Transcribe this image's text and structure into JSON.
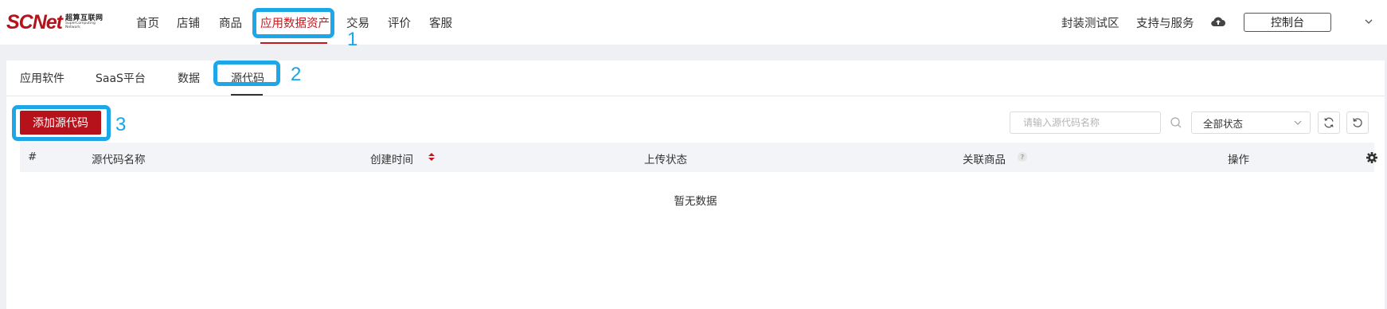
{
  "header": {
    "logo": {
      "main": "SCNet",
      "cn": "超算互联网",
      "en1": "SuperComputing",
      "en2": "Network"
    },
    "nav": [
      {
        "label": "首页"
      },
      {
        "label": "店铺"
      },
      {
        "label": "商品"
      },
      {
        "label": "应用数据资产",
        "active": true
      },
      {
        "label": "交易"
      },
      {
        "label": "评价"
      },
      {
        "label": "客服"
      }
    ],
    "right": {
      "sandbox": "封装测试区",
      "support": "支持与服务",
      "console": "控制台"
    }
  },
  "annotations": [
    "1",
    "2",
    "3"
  ],
  "subtabs": [
    {
      "label": "应用软件"
    },
    {
      "label": "SaaS平台"
    },
    {
      "label": "数据"
    },
    {
      "label": "源代码",
      "active": true
    }
  ],
  "toolbar": {
    "add_label": "添加源代码",
    "search_placeholder": "请输入源代码名称",
    "status_select": "全部状态"
  },
  "table": {
    "columns": [
      "#",
      "源代码名称",
      "创建时间",
      "上传状态",
      "关联商品",
      "操作"
    ],
    "rows": [],
    "empty_text": "暂无数据"
  },
  "colors": {
    "accent": "#b5121b",
    "annotation": "#1ea7e8"
  }
}
